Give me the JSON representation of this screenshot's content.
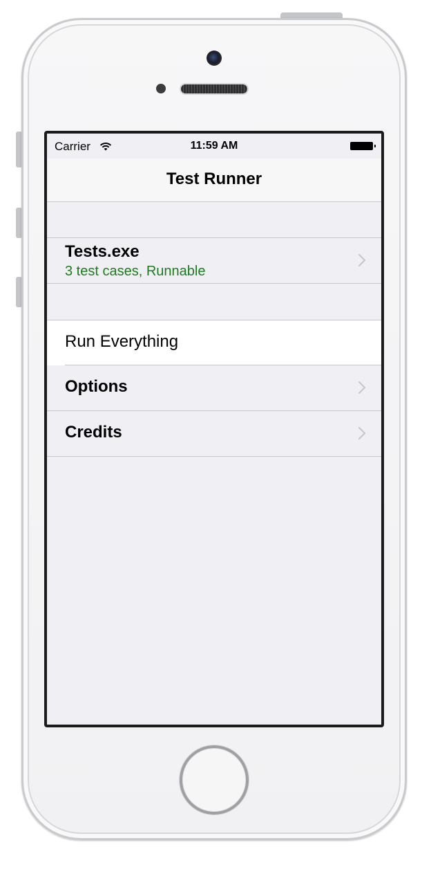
{
  "status_bar": {
    "carrier": "Carrier",
    "time": "11:59 AM",
    "wifi_icon": "wifi-icon",
    "battery_icon": "battery-icon"
  },
  "nav": {
    "title": "Test Runner"
  },
  "sections": {
    "assembly": {
      "title": "Tests.exe",
      "detail": "3 test cases, Runnable",
      "detail_color": "#1f7a1f"
    },
    "actions": [
      {
        "label": "Run Everything",
        "style": "plain"
      },
      {
        "label": "Options",
        "style": "bold"
      },
      {
        "label": "Credits",
        "style": "bold"
      }
    ]
  },
  "colors": {
    "background": "#efeff4",
    "separator": "#c8c7cc",
    "chevron": "#c7c7cc",
    "navbar": "#f7f7f7"
  }
}
